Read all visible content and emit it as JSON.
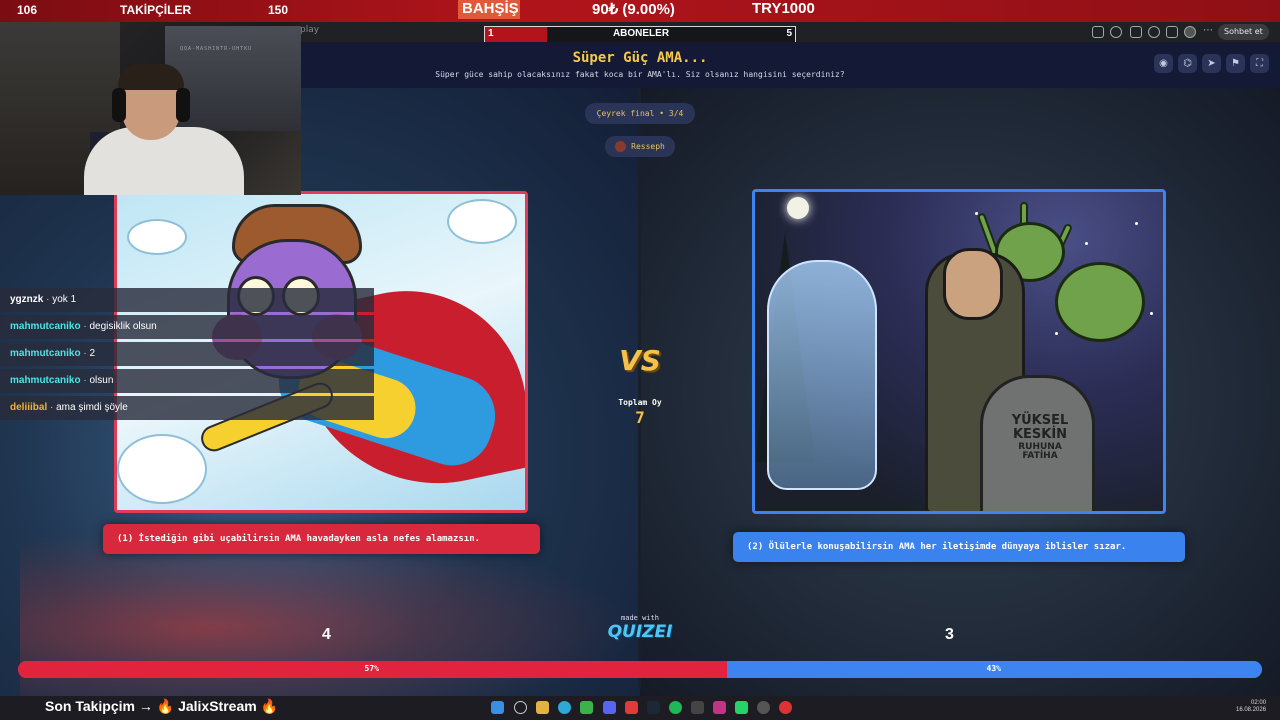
{
  "stream_top": {
    "left_count": "106",
    "followers_label": "TAKİPÇİLER",
    "followers_goal": "150",
    "bet_label": "BAHŞİŞ",
    "bet_value": "90₺ (9.00%)",
    "bet_goal": "TRY1000"
  },
  "subs_goal": {
    "label": "ABONELER",
    "current": "1",
    "target": "5",
    "progress": 0.2
  },
  "browser": {
    "url_fragment": "play",
    "chat_button": "Sohbet et",
    "icons": [
      "star-icon",
      "extension-icon",
      "shield-icon",
      "history-icon",
      "download-icon",
      "profile-icon",
      "menu-icon"
    ]
  },
  "quiz": {
    "title": "Süper Güç AMA...",
    "subtitle": "Süper güce sahip olacaksınız fakat koca bir AMA'lı. Siz olsanız hangisini seçerdiniz?",
    "round": "Çeyrek final • 3/4",
    "author": "Resseph",
    "total_label": "Toplam Oy",
    "total_votes": "7",
    "vs_text": "VS",
    "made_with": "made with",
    "brand": "QUIZEI",
    "tools": [
      "eye-icon",
      "link-icon",
      "share-icon",
      "flag-icon",
      "fullscreen-icon"
    ]
  },
  "options": [
    {
      "text": "(1) İstediğin gibi uçabilirsin AMA havadayken asla nefes alamazsın.",
      "votes": "4",
      "percent_label": "57%",
      "percent": 57,
      "color": "#e2233d"
    },
    {
      "text": "(2) Ölülerle konuşabilirsin AMA her iletişimde dünyaya iblisler sızar.",
      "votes": "3",
      "percent_label": "43%",
      "percent": 43,
      "color": "#3d84f0"
    }
  ],
  "grave_text": [
    "YÜKSEL",
    "KESKİN",
    "RUHUNA",
    "FATİHA"
  ],
  "chat": [
    {
      "user": "ygznzk",
      "message": "yok 1",
      "color": "#ffffff"
    },
    {
      "user": "mahmutcaniko",
      "message": "degisiklik olsun",
      "color": "#4fe3e3"
    },
    {
      "user": "mahmutcaniko",
      "message": "2",
      "color": "#4fe3e3"
    },
    {
      "user": "mahmutcaniko",
      "message": "olsun",
      "color": "#4fe3e3"
    },
    {
      "user": "deliiibal",
      "message": "ama şimdi şöyle",
      "color": "#f2b233"
    }
  ],
  "bottom": {
    "follower_text": "Son Takipçim → 🔥 JalixStream 🔥",
    "time": "02:00",
    "date": "16.08.2026"
  },
  "webcam_tag": "QQA-MASHINTR-UHTKU"
}
